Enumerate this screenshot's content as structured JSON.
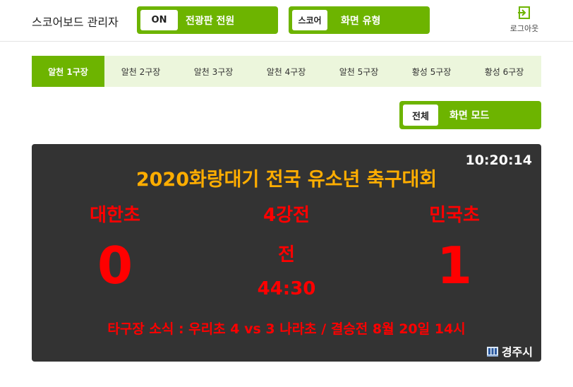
{
  "header": {
    "title": "스코어보드 관리자",
    "power_toggle": {
      "state": "ON",
      "label": "전광판 전원"
    },
    "type_toggle": {
      "state": "스코어",
      "label": "화면 유형"
    },
    "logout": {
      "label": "로그아웃",
      "icon": "logout-icon"
    }
  },
  "tabs": [
    {
      "label": "알천 1구장",
      "active": true
    },
    {
      "label": "알천 2구장",
      "active": false
    },
    {
      "label": "알천 3구장",
      "active": false
    },
    {
      "label": "알천 4구장",
      "active": false
    },
    {
      "label": "알천 5구장",
      "active": false
    },
    {
      "label": "황성 5구장",
      "active": false
    },
    {
      "label": "황성 6구장",
      "active": false
    }
  ],
  "mode_toggle": {
    "state": "전체",
    "label": "화면 모드"
  },
  "scoreboard": {
    "clock": "10:20:14",
    "title": "2020화랑대기 전국 유소년 축구대회",
    "home": {
      "name": "대한초",
      "score": "0"
    },
    "away": {
      "name": "민국초",
      "score": "1"
    },
    "round": "4강전",
    "half": "전",
    "match_time": "44:30",
    "news": "타구장 소식 : 우리초 4 vs 3 나라초 / 결승전 8월 20일 14시",
    "brand": "경주시"
  },
  "colors": {
    "accent": "#6db400",
    "tab_bg": "#ecf6dc",
    "board_bg": "#333333",
    "title": "#ffad00",
    "score": "#ff0000"
  }
}
